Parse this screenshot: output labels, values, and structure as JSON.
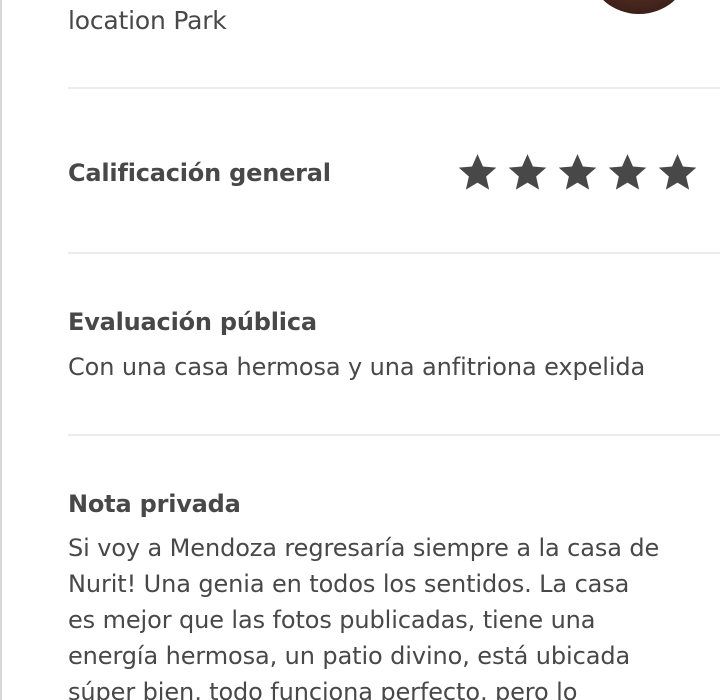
{
  "header": {
    "location_text": "location Park"
  },
  "rating": {
    "label": "Calificación general",
    "stars_filled": 5,
    "stars_total": 5,
    "star_color": "#484848"
  },
  "public_review": {
    "heading": "Evaluación pública",
    "text": "Con una casa hermosa y una anfitriona expelida"
  },
  "private_note": {
    "heading": "Nota privada",
    "lines": [
      "Si voy a Mendoza regresaría siempre a la casa de",
      "Nurit! Una genia en todos los sentidos. La casa",
      "es mejor que las fotos publicadas, tiene una",
      "energía hermosa, un patio divino, está ubicada",
      "súper bien, todo funciona perfecto, pero lo"
    ]
  }
}
